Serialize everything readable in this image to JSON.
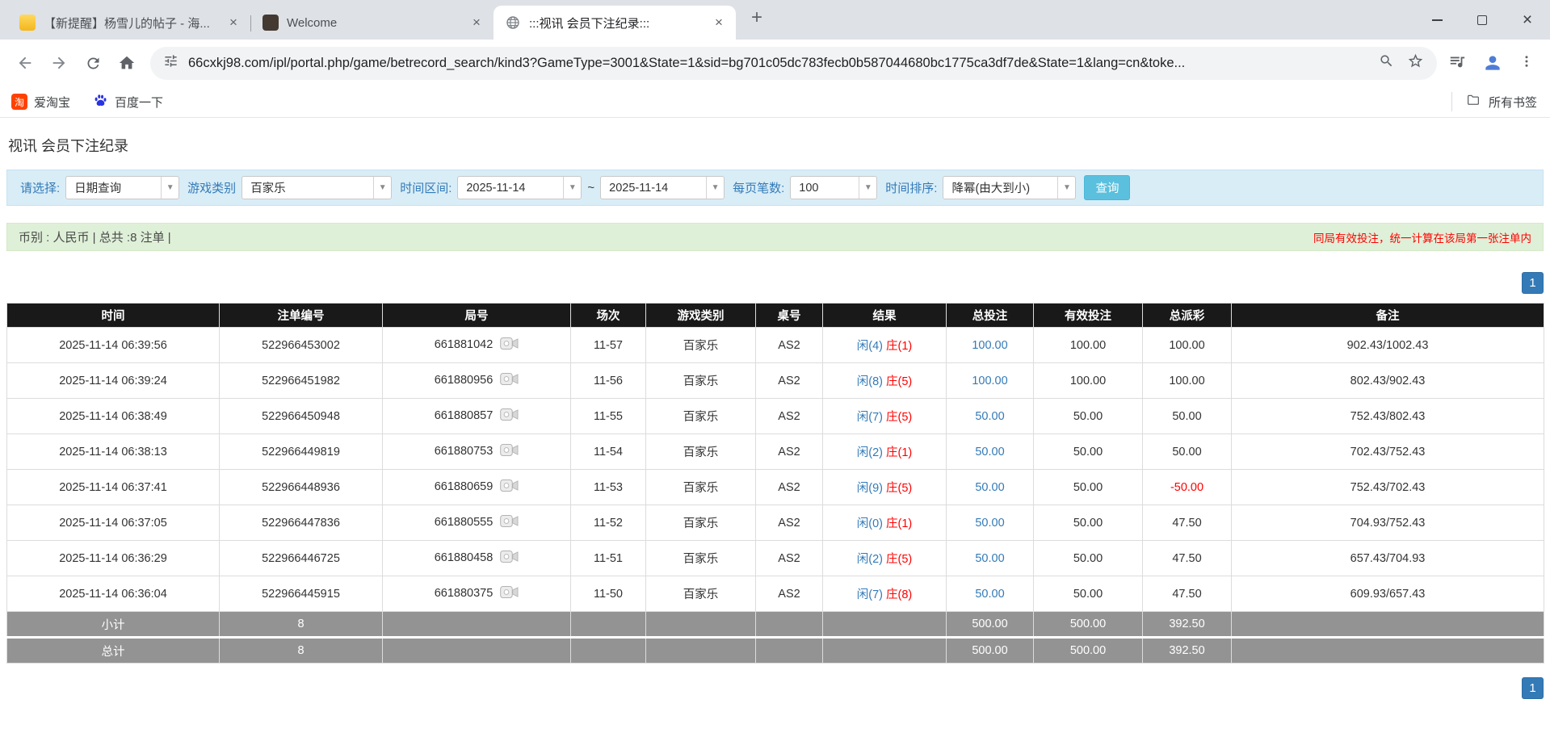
{
  "browser": {
    "tabs": [
      {
        "title": "【新提醒】杨雪儿的帖子 - 海..."
      },
      {
        "title": "Welcome"
      },
      {
        "title": ":::视讯 会员下注纪录:::"
      }
    ],
    "url": "66cxkj98.com/ipl/portal.php/game/betrecord_search/kind3?GameType=3001&State=1&sid=bg701c05dc783fecb0b587044680bc1775ca3df7de&State=1&lang=cn&toke...",
    "bookmarks": [
      {
        "label": "爱淘宝",
        "icon_glyph": "淘"
      },
      {
        "label": "百度一下"
      }
    ],
    "all_bookmarks_label": "所有书签",
    "icons": {
      "tab_favicons": [
        "yellow-forum-icon",
        "dark-site-icon",
        "globe-icon"
      ],
      "toolbar": [
        "back-icon",
        "forward-icon",
        "reload-icon",
        "home-icon",
        "site-info-icon",
        "zoom-icon",
        "bookmark-star-icon",
        "media-controls-icon",
        "profile-icon",
        "menu-icon"
      ],
      "bookmarks": [
        "taobao-icon",
        "baidu-paw-icon",
        "folder-icon"
      ],
      "table": [
        "video-replay-icon"
      ]
    }
  },
  "page": {
    "title": "视讯 会员下注纪录",
    "filters": {
      "select_label": "请选择:",
      "select_value": "日期查询",
      "game_type_label": "游戏类别",
      "game_type_value": "百家乐",
      "date_range_label": "时间区间:",
      "date_from": "2025-11-14",
      "range_separator": "~",
      "date_to": "2025-11-14",
      "per_page_label": "每页笔数:",
      "per_page_value": "100",
      "sort_label": "时间排序:",
      "sort_value": "降幂(由大到小)",
      "query_button": "查询"
    },
    "info_bar": {
      "left": "币别 : 人民币 | 总共 :8 注单 |",
      "right": "同局有效投注，统一计算在该局第一张注单内"
    },
    "pagination": {
      "current_page": "1"
    },
    "table": {
      "headers": [
        "时间",
        "注单编号",
        "局号",
        "场次",
        "游戏类别",
        "桌号",
        "结果",
        "总投注",
        "有效投注",
        "总派彩",
        "备注"
      ],
      "rows": [
        {
          "time": "2025-11-14 06:39:56",
          "bet_id": "522966453002",
          "round_id": "661881042",
          "session": "11-57",
          "game": "百家乐",
          "table_no": "AS2",
          "player": "闲(4)",
          "banker": "庄(1)",
          "total_bet": "100.00",
          "valid_bet": "100.00",
          "payout": "100.00",
          "note": "902.43/1002.43"
        },
        {
          "time": "2025-11-14 06:39:24",
          "bet_id": "522966451982",
          "round_id": "661880956",
          "session": "11-56",
          "game": "百家乐",
          "table_no": "AS2",
          "player": "闲(8)",
          "banker": "庄(5)",
          "total_bet": "100.00",
          "valid_bet": "100.00",
          "payout": "100.00",
          "note": "802.43/902.43"
        },
        {
          "time": "2025-11-14 06:38:49",
          "bet_id": "522966450948",
          "round_id": "661880857",
          "session": "11-55",
          "game": "百家乐",
          "table_no": "AS2",
          "player": "闲(7)",
          "banker": "庄(5)",
          "total_bet": "50.00",
          "valid_bet": "50.00",
          "payout": "50.00",
          "note": "752.43/802.43"
        },
        {
          "time": "2025-11-14 06:38:13",
          "bet_id": "522966449819",
          "round_id": "661880753",
          "session": "11-54",
          "game": "百家乐",
          "table_no": "AS2",
          "player": "闲(2)",
          "banker": "庄(1)",
          "total_bet": "50.00",
          "valid_bet": "50.00",
          "payout": "50.00",
          "note": "702.43/752.43"
        },
        {
          "time": "2025-11-14 06:37:41",
          "bet_id": "522966448936",
          "round_id": "661880659",
          "session": "11-53",
          "game": "百家乐",
          "table_no": "AS2",
          "player": "闲(9)",
          "banker": "庄(5)",
          "total_bet": "50.00",
          "valid_bet": "50.00",
          "payout": "-50.00",
          "note": "752.43/702.43"
        },
        {
          "time": "2025-11-14 06:37:05",
          "bet_id": "522966447836",
          "round_id": "661880555",
          "session": "11-52",
          "game": "百家乐",
          "table_no": "AS2",
          "player": "闲(0)",
          "banker": "庄(1)",
          "total_bet": "50.00",
          "valid_bet": "50.00",
          "payout": "47.50",
          "note": "704.93/752.43"
        },
        {
          "time": "2025-11-14 06:36:29",
          "bet_id": "522966446725",
          "round_id": "661880458",
          "session": "11-51",
          "game": "百家乐",
          "table_no": "AS2",
          "player": "闲(2)",
          "banker": "庄(5)",
          "total_bet": "50.00",
          "valid_bet": "50.00",
          "payout": "47.50",
          "note": "657.43/704.93"
        },
        {
          "time": "2025-11-14 06:36:04",
          "bet_id": "522966445915",
          "round_id": "661880375",
          "session": "11-50",
          "game": "百家乐",
          "table_no": "AS2",
          "player": "闲(7)",
          "banker": "庄(8)",
          "total_bet": "50.00",
          "valid_bet": "50.00",
          "payout": "47.50",
          "note": "609.93/657.43"
        }
      ],
      "subtotal": {
        "label": "小计",
        "count": "8",
        "total_bet": "500.00",
        "valid_bet": "500.00",
        "payout": "392.50"
      },
      "total": {
        "label": "总计",
        "count": "8",
        "total_bet": "500.00",
        "valid_bet": "500.00",
        "payout": "392.50"
      }
    }
  },
  "colors": {
    "accent_blue": "#337ab7",
    "query_button": "#5bc0de",
    "banker_red": "#ff0000",
    "negative_red": "#ff0000",
    "table_header_bg": "#191919",
    "footer_row_bg": "#939393",
    "filter_bar_bg": "#d9edf7",
    "info_bar_bg": "#dff0d8"
  }
}
